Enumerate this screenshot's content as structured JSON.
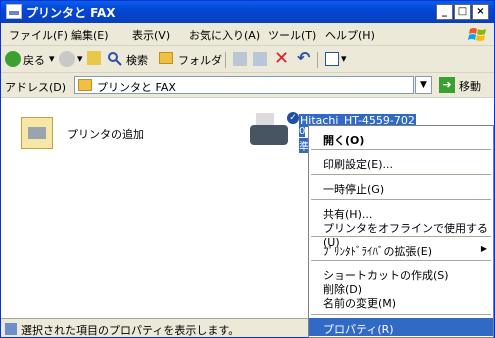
{
  "window": {
    "title": "プリンタと FAX"
  },
  "menubar": [
    "ファイル(F)",
    "編集(E)",
    "表示(V)",
    "お気に入り(A)",
    "ツール(T)",
    "ヘルプ(H)"
  ],
  "toolbar": {
    "back": "戻る",
    "search": "検索",
    "folders": "フォルダ"
  },
  "address": {
    "label": "アドレス(D)",
    "value": "プリンタと FAX",
    "go": "移動"
  },
  "items": [
    {
      "label": "プリンタの追加"
    },
    {
      "label": "Hitachi_HT-4559-702",
      "sub1": "0",
      "sub2": "準"
    }
  ],
  "context_menu": [
    {
      "label": "開く(O)",
      "bold": true
    },
    {
      "label": "印刷設定(E)..."
    },
    {
      "label": "一時停止(G)"
    },
    {
      "label": "共有(H)..."
    },
    {
      "label": "プリンタをオフラインで使用する(U)"
    },
    {
      "label": "ﾌﾟﾘﾝﾀﾄﾞﾗｲﾊﾞの拡張(E)",
      "submenu": true
    },
    {
      "label": "ショートカットの作成(S)"
    },
    {
      "label": "削除(D)"
    },
    {
      "label": "名前の変更(M)"
    },
    {
      "label": "プロパティ(R)",
      "selected": true
    }
  ],
  "status": {
    "text": "選択された項目のプロパティを表示します。"
  }
}
